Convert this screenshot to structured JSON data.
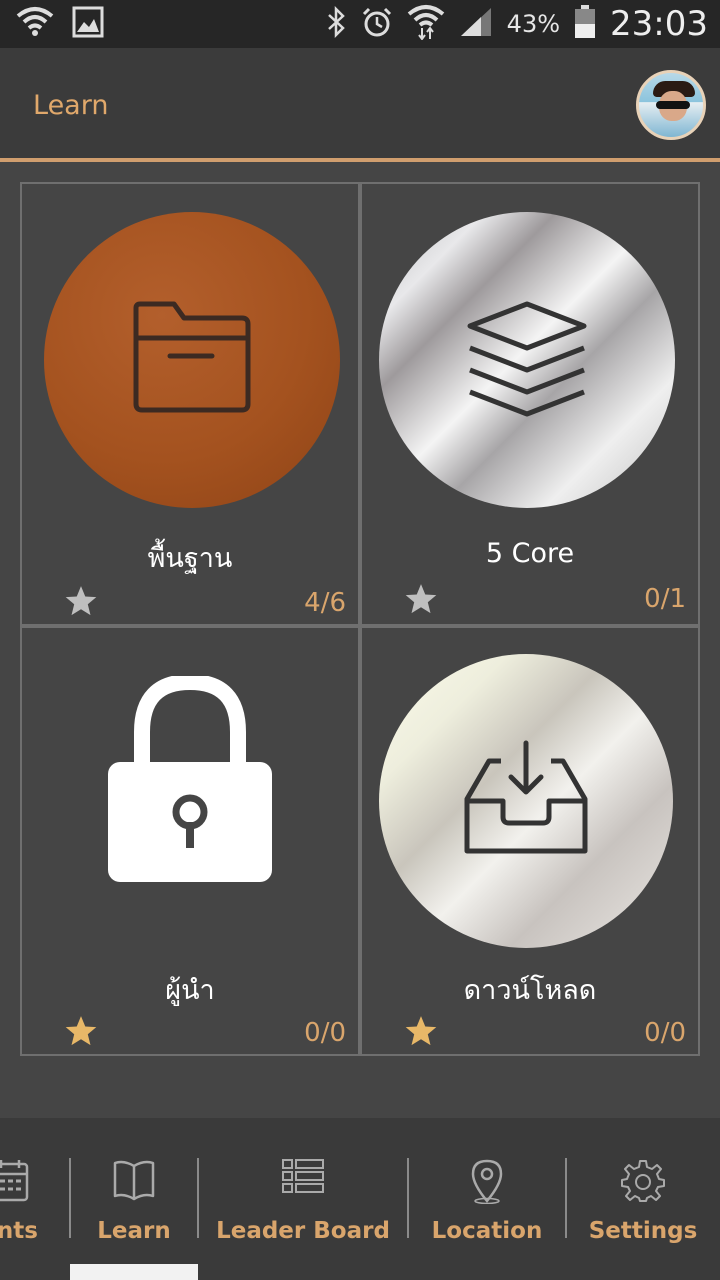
{
  "status_bar": {
    "battery": "43%",
    "time": "23:03"
  },
  "header": {
    "title": "Learn"
  },
  "cards": [
    {
      "title": "พื้นฐาน",
      "count": "4/6",
      "icon": "folder-icon"
    },
    {
      "title": "5 Core",
      "count": "0/1",
      "icon": "layers-icon"
    },
    {
      "title": "ผู้นำ",
      "count": "0/0",
      "icon": "lock-icon"
    },
    {
      "title": "ดาวน์โหลด",
      "count": "0/0",
      "icon": "download-tray-icon"
    }
  ],
  "nav": {
    "items": [
      {
        "label": "ents",
        "icon": "calendar-icon"
      },
      {
        "label": "Learn",
        "icon": "book-icon"
      },
      {
        "label": "Leader Board",
        "icon": "list-icon"
      },
      {
        "label": "Location",
        "icon": "location-pin-icon"
      },
      {
        "label": "Settings",
        "icon": "gear-icon"
      }
    ]
  },
  "colors": {
    "accent": "#d9a56c",
    "star_active": "#e8b868",
    "star_inactive": "#bfbfbf",
    "background": "#454545",
    "appbar": "#3b3b3b",
    "bronze": "#a4521f"
  }
}
